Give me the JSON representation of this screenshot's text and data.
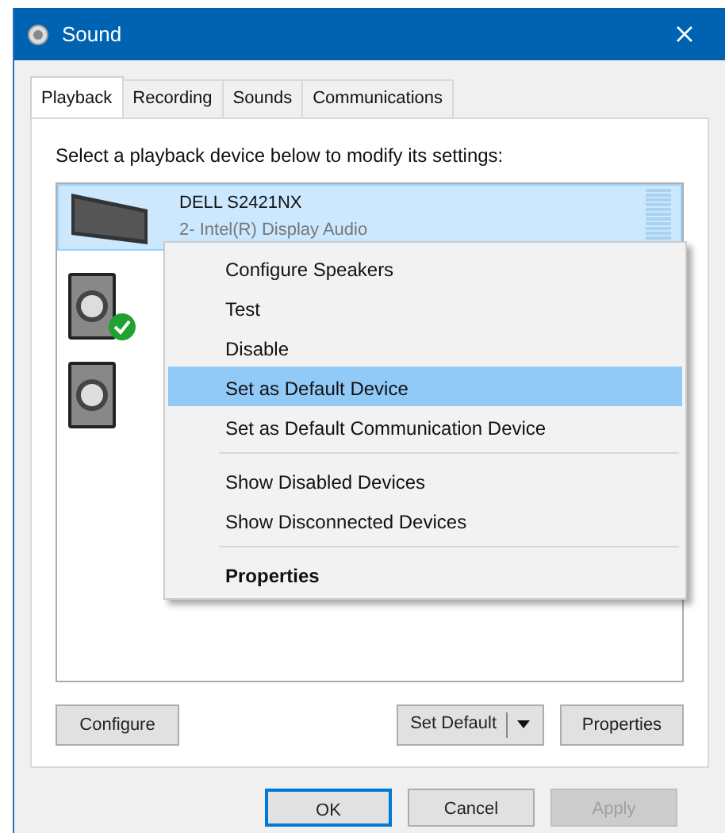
{
  "window": {
    "title": "Sound"
  },
  "tabs": [
    {
      "label": "Playback",
      "selected": true
    },
    {
      "label": "Recording",
      "selected": false
    },
    {
      "label": "Sounds",
      "selected": false
    },
    {
      "label": "Communications",
      "selected": false
    }
  ],
  "instruction": "Select a playback device below to modify its settings:",
  "devices": [
    {
      "kind": "monitor",
      "name": "DELL S2421NX",
      "description": "2- Intel(R) Display Audio",
      "selected": true,
      "default": false
    },
    {
      "kind": "speaker",
      "selected": false,
      "default": true
    },
    {
      "kind": "speaker",
      "selected": false,
      "default": false
    }
  ],
  "context_menu": {
    "items": [
      {
        "kind": "item",
        "label": "Configure Speakers",
        "selected": false,
        "bold": false
      },
      {
        "kind": "item",
        "label": "Test",
        "selected": false,
        "bold": false
      },
      {
        "kind": "item",
        "label": "Disable",
        "selected": false,
        "bold": false
      },
      {
        "kind": "item",
        "label": "Set as Default Device",
        "selected": true,
        "bold": false
      },
      {
        "kind": "item",
        "label": "Set as Default Communication Device",
        "selected": false,
        "bold": false
      },
      {
        "kind": "separator"
      },
      {
        "kind": "item",
        "label": "Show Disabled Devices",
        "selected": false,
        "bold": false
      },
      {
        "kind": "item",
        "label": "Show Disconnected Devices",
        "selected": false,
        "bold": false
      },
      {
        "kind": "separator"
      },
      {
        "kind": "item",
        "label": "Properties",
        "selected": false,
        "bold": true
      }
    ]
  },
  "device_buttons": {
    "configure": "Configure",
    "set_default": "Set Default",
    "properties": "Properties"
  },
  "dialog_buttons": [
    {
      "label": "OK",
      "focused": true,
      "disabled": false
    },
    {
      "label": "Cancel",
      "focused": false,
      "disabled": false
    },
    {
      "label": "Apply",
      "focused": false,
      "disabled": true
    }
  ]
}
